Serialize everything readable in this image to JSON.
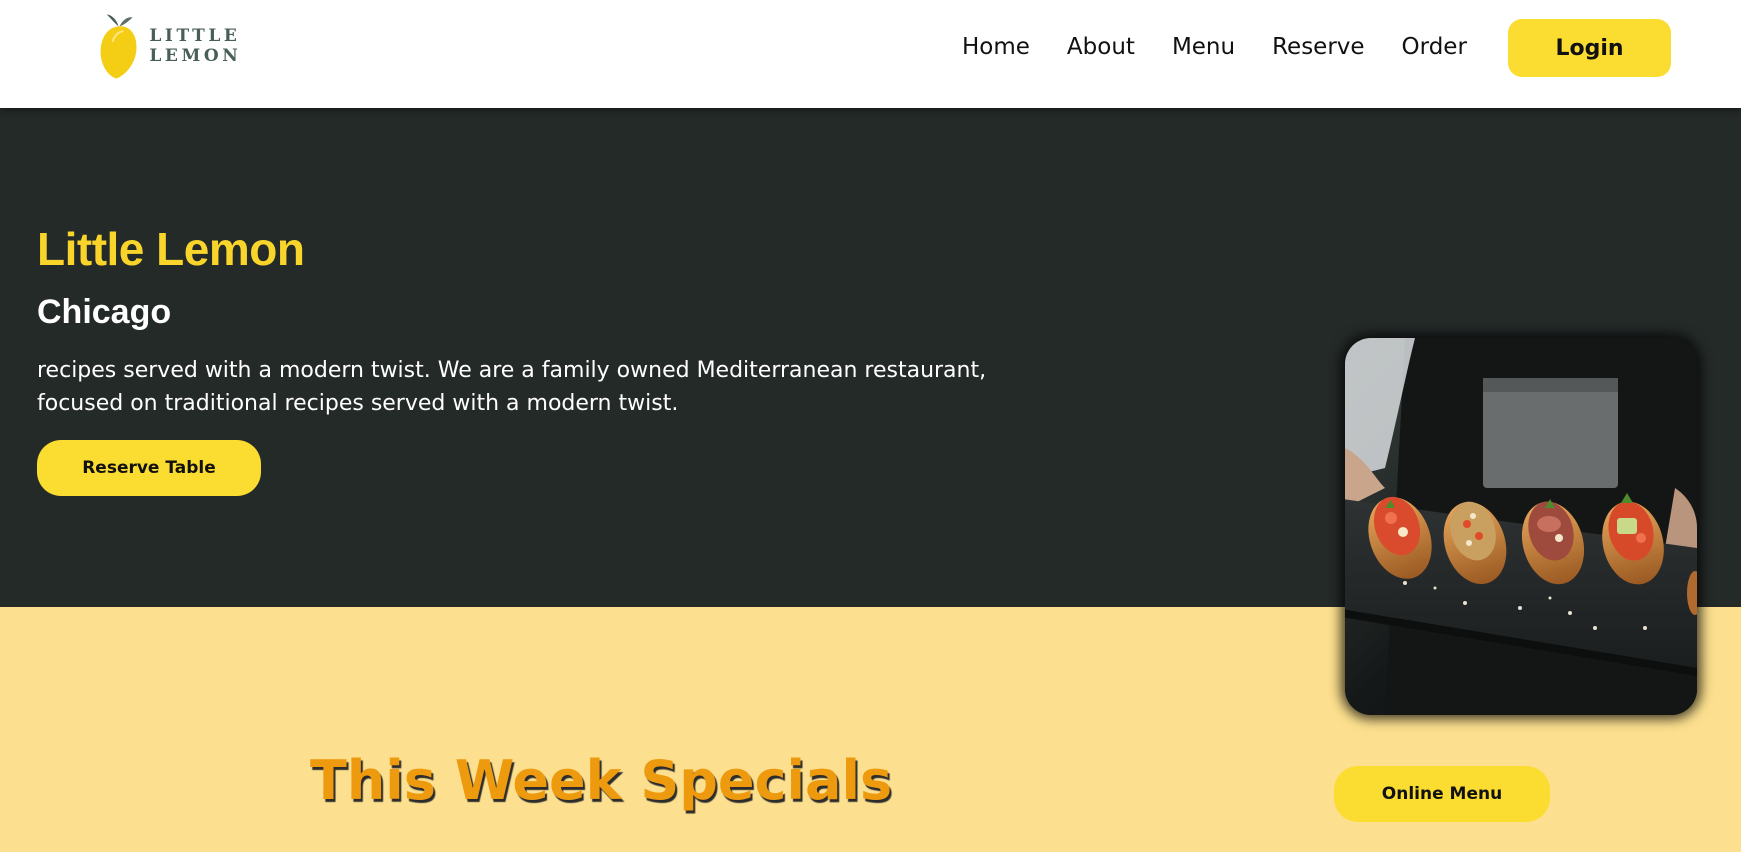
{
  "brand": {
    "logo_text": "LITTLE LEMON",
    "lemon_color": "#f4ce14",
    "leaf_color": "#495e57"
  },
  "nav": {
    "items": [
      {
        "label": "Home"
      },
      {
        "label": "About"
      },
      {
        "label": "Menu"
      },
      {
        "label": "Reserve"
      },
      {
        "label": "Order"
      }
    ],
    "login_label": "Login"
  },
  "hero": {
    "title": "Little Lemon",
    "subtitle": "Chicago",
    "description": "recipes served with a modern twist. We are a family owned Mediterranean restaurant, focused on traditional recipes served with a modern twist.",
    "reserve_label": "Reserve Table",
    "image_icon": "restaurant-food-photo"
  },
  "specials": {
    "title": "This Week Specials",
    "online_menu_label": "Online Menu"
  },
  "colors": {
    "hero_bg": "#242a28",
    "accent_yellow": "#fbdc30",
    "title_yellow": "#f9d52b",
    "specials_bg": "#fde08f",
    "specials_title": "#ee9a0e"
  }
}
